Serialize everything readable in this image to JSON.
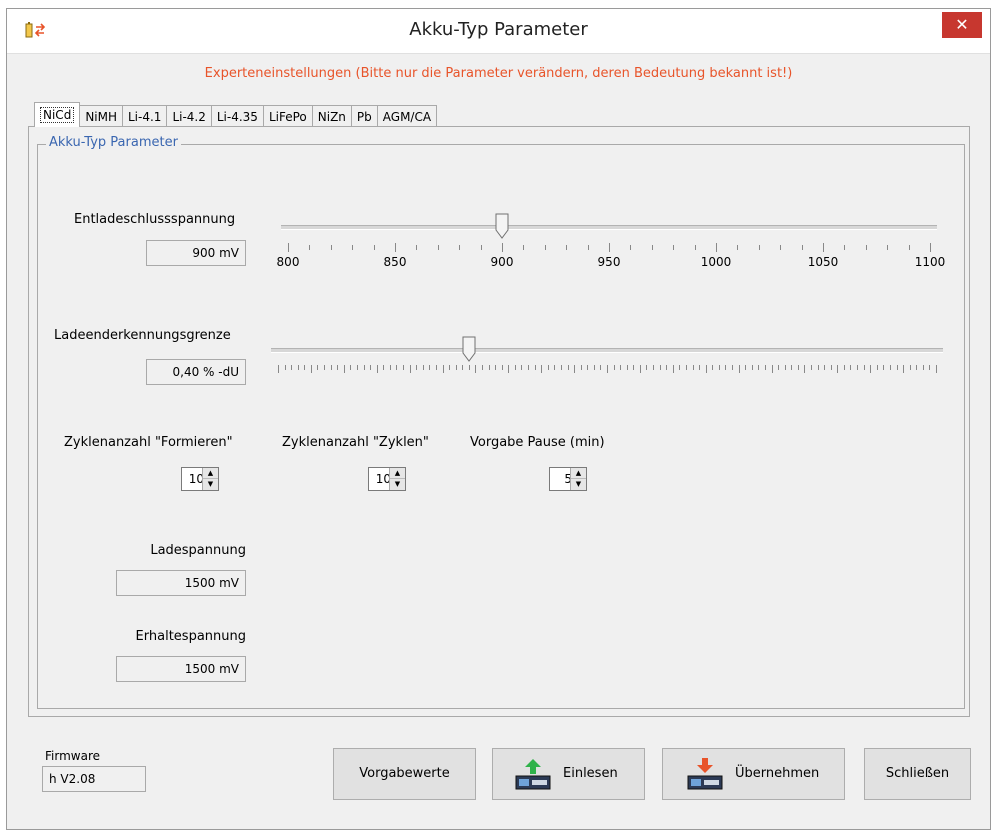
{
  "window": {
    "title": "Akku-Typ Parameter",
    "close": "✕"
  },
  "expert_note": "Experteneinstellungen (Bitte nur die Parameter verändern, deren Bedeutung bekannt ist!)",
  "tabs": [
    "NiCd",
    "NiMH",
    "Li-4.1",
    "Li-4.2",
    "Li-4.35",
    "LiFePo",
    "NiZn",
    "Pb",
    "AGM/CA"
  ],
  "active_tab": "NiCd",
  "group": {
    "title": "Akku-Typ Parameter"
  },
  "entlade": {
    "label": "Entladeschlussspannung",
    "value": "900 mV",
    "slider_value": 900,
    "slider_min": 800,
    "slider_max": 1100,
    "tick_labels": [
      "800",
      "850",
      "900",
      "950",
      "1000",
      "1050",
      "1100"
    ]
  },
  "ladeende": {
    "label": "Ladeenderkennungsgrenze",
    "value": "0,40 % -dU",
    "slider_fraction": 0.29
  },
  "zyklen_formieren": {
    "label": "Zyklenanzahl \"Formieren\"",
    "value": "10"
  },
  "zyklen_zyklen": {
    "label": "Zyklenanzahl \"Zyklen\"",
    "value": "10"
  },
  "pause": {
    "label": "Vorgabe Pause (min)",
    "value": "5"
  },
  "ladespannung": {
    "label": "Ladespannung",
    "value": "1500 mV"
  },
  "erhaltespannung": {
    "label": "Erhaltespannung",
    "value": "1500 mV"
  },
  "firmware": {
    "label": "Firmware",
    "value": "h  V2.08"
  },
  "buttons": {
    "defaults": "Vorgabewerte",
    "read": "Einlesen",
    "apply": "Übernehmen",
    "close": "Schließen"
  },
  "colors": {
    "note": "#e8542a",
    "group_title": "#3a66b0",
    "close_bg": "#c7372f",
    "arrow_up": "#2fb24a",
    "arrow_down": "#e8542a"
  }
}
